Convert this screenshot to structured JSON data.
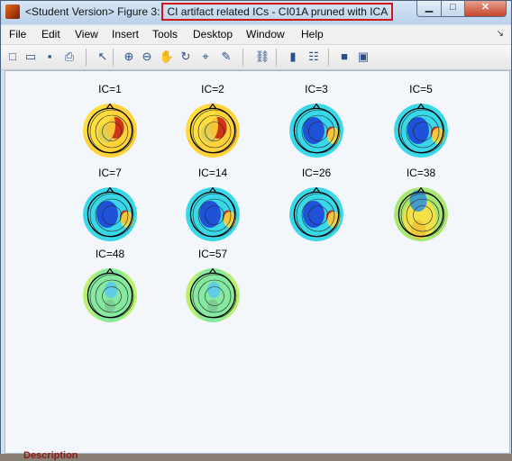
{
  "window": {
    "title_prefix": "<Student Version> Figure 3:",
    "title_highlight": "CI artifact related ICs - CI01A pruned with ICA"
  },
  "menu": [
    "File",
    "Edit",
    "View",
    "Insert",
    "Tools",
    "Desktop",
    "Window",
    "Help"
  ],
  "toolbar": [
    {
      "name": "new-figure-icon",
      "glyph": "□"
    },
    {
      "name": "open-file-icon",
      "glyph": "▭"
    },
    {
      "name": "save-icon",
      "glyph": "▪"
    },
    {
      "name": "print-icon",
      "glyph": "⎙"
    },
    {
      "name": "select-arrow-icon",
      "glyph": "↖"
    },
    {
      "name": "zoom-in-icon",
      "glyph": "⊕"
    },
    {
      "name": "zoom-out-icon",
      "glyph": "⊖"
    },
    {
      "name": "pan-hand-icon",
      "glyph": "✋"
    },
    {
      "name": "rotate-3d-icon",
      "glyph": "↻"
    },
    {
      "name": "data-cursor-icon",
      "glyph": "⌖"
    },
    {
      "name": "brush-icon",
      "glyph": "✎"
    },
    {
      "name": "link-plot-icon",
      "glyph": "⛓"
    },
    {
      "name": "colorbar-icon",
      "glyph": "▮"
    },
    {
      "name": "legend-icon",
      "glyph": "☷"
    },
    {
      "name": "hide-plot-tools-icon",
      "glyph": "■"
    },
    {
      "name": "show-plot-tools-icon",
      "glyph": "▣"
    }
  ],
  "components": [
    {
      "label": "IC=1",
      "pattern": "warm"
    },
    {
      "label": "IC=2",
      "pattern": "warm"
    },
    {
      "label": "IC=3",
      "pattern": "cool"
    },
    {
      "label": "IC=5",
      "pattern": "cool"
    },
    {
      "label": "IC=7",
      "pattern": "cool"
    },
    {
      "label": "IC=14",
      "pattern": "cool"
    },
    {
      "label": "IC=26",
      "pattern": "cool"
    },
    {
      "label": "IC=38",
      "pattern": "warm-low"
    },
    {
      "label": "IC=48",
      "pattern": "flat"
    },
    {
      "label": "IC=57",
      "pattern": "flat"
    }
  ],
  "colors": {
    "title_highlight_border": "#d01818",
    "figure_background": "#f3f7fc"
  },
  "background_text": "Description"
}
